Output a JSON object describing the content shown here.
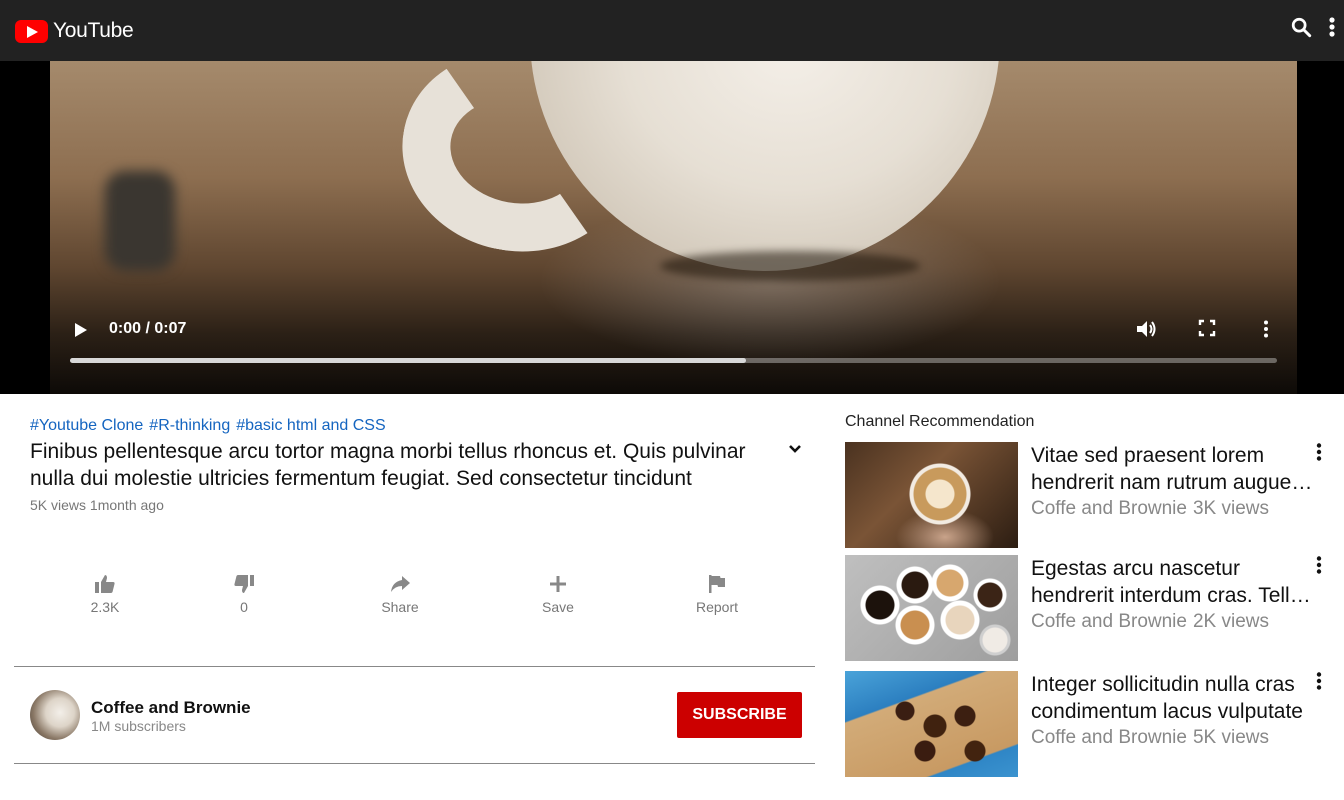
{
  "app": {
    "brand": "YouTube",
    "brand_color": "#ff0000",
    "header_bg": "#222222",
    "header_icons": [
      "search-icon",
      "more-vert-icon"
    ]
  },
  "player": {
    "time": "0:00 / 0:07",
    "progress_fraction": 0.56,
    "controls": [
      "play-icon",
      "volume-icon",
      "fullscreen-icon",
      "more-vert-icon"
    ]
  },
  "video": {
    "hashtags": [
      "#Youtube Clone",
      "#R-thinking",
      "#basic html and CSS"
    ],
    "title": "Finibus pellentesque arcu tortor magna morbi tellus rhoncus et. Quis pulvinar nulla dui molestie ultricies fermentum feugiat. Sed consectetur tincidunt",
    "meta": "5K views 1month ago",
    "actions": [
      {
        "icon": "thumb-up-icon",
        "label": "2.3K"
      },
      {
        "icon": "thumb-down-icon",
        "label": "0"
      },
      {
        "icon": "share-icon",
        "label": "Share"
      },
      {
        "icon": "add-icon",
        "label": "Save"
      },
      {
        "icon": "flag-icon",
        "label": "Report"
      }
    ]
  },
  "channel": {
    "name": "Coffee and Brownie",
    "subscribers": "1M subscribers",
    "subscribe_label": "SUBSCRIBE",
    "subscribe_color": "#cc0000"
  },
  "recommendations": {
    "heading": "Channel Recommendation",
    "items": [
      {
        "title": "Vitae sed praesent lorem hendrerit nam rutrum augue faucibus",
        "channel": "Coffe and Brownie",
        "views": "3K views"
      },
      {
        "title": "Egestas arcu nascetur hendrerit interdum cras. Tellus mauris",
        "channel": "Coffe and Brownie",
        "views": "2K views"
      },
      {
        "title": "Integer sollicitudin nulla cras condimentum lacus vulputate",
        "channel": "Coffe and Brownie",
        "views": "5K views"
      }
    ]
  },
  "accent_link_color": "#1565c0"
}
